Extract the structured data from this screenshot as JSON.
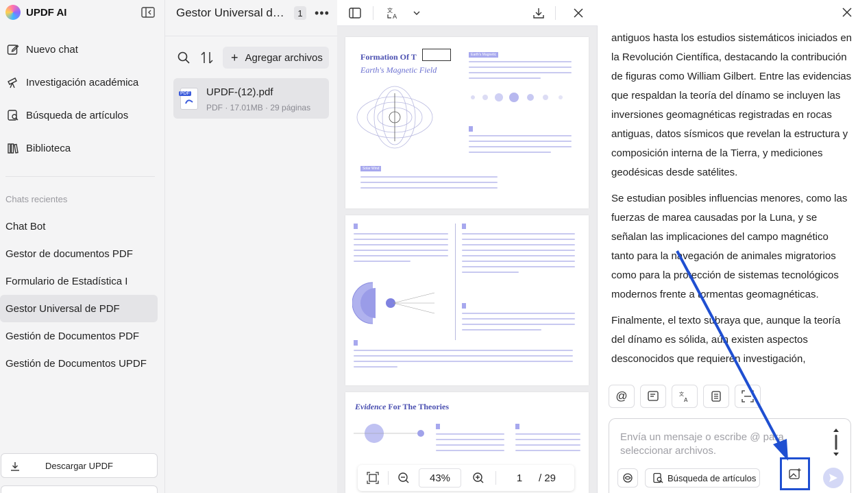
{
  "sidebar": {
    "brand": "UPDF AI",
    "nav": [
      {
        "label": "Nuevo chat"
      },
      {
        "label": "Investigación académica"
      },
      {
        "label": "Búsqueda de artículos"
      },
      {
        "label": "Biblioteca"
      }
    ],
    "recent_label": "Chats recientes",
    "recent": [
      {
        "label": "Chat Bot"
      },
      {
        "label": "Gestor de documentos PDF"
      },
      {
        "label": "Formulario de Estadística I"
      },
      {
        "label": "Gestor Universal de PDF"
      },
      {
        "label": "Gestión de Documentos PDF"
      },
      {
        "label": "Gestión de Documentos UPDF"
      }
    ],
    "download_label": "Descargar UPDF"
  },
  "files": {
    "title": "Gestor Universal de PDF",
    "count": "1",
    "add_label": "Agregar archivos",
    "items": [
      {
        "name": "UPDF-(12).pdf",
        "meta": "PDF · 17.01MB · 29 páginas",
        "tag": "PDF"
      }
    ]
  },
  "viewer": {
    "page1": {
      "title": "Formation Of T",
      "subtitle": "Earth's Magnetic Field",
      "tags": [
        "Earth's Magnetic",
        "Solar Wind"
      ]
    },
    "page3": {
      "title_italic": "Evidence",
      "title_rest": " For The Theories"
    },
    "zoom": "43%",
    "page_current": "1",
    "page_total": "/ 29"
  },
  "chat": {
    "paragraphs": [
      "antiguos hasta los estudios sistemáticos iniciados en la Revolución Científica, destacando la contribución de figuras como William Gilbert. Entre las evidencias que respaldan la teoría del dínamo se incluyen las inversiones geomagnéticas registradas en rocas antiguas, datos sísmicos que revelan la estructura y composición interna de la Tierra, y mediciones geodésicas desde satélites.",
      "Se estudian posibles influencias menores, como las fuerzas de marea causadas por la Luna, y se señalan las implicaciones del campo magnético tanto para la navegación de animales migratorios como para la protección de sistemas tecnológicos modernos frente a tormentas geomagnéticas.",
      "Finalmente, el texto subraya que, aunque la teoría del dínamo es sólida, aún existen aspectos desconocidos que requieren investigación,"
    ],
    "tools": [
      {
        "icon": "at-icon",
        "glyph": "@"
      },
      {
        "icon": "note-icon"
      },
      {
        "icon": "translate-icon"
      },
      {
        "icon": "outline-icon"
      },
      {
        "icon": "scan-icon"
      }
    ],
    "input_placeholder": "Envía un mensaje o escribe @ para seleccionar archivos.",
    "search_label": "Búsqueda de artículos"
  },
  "colors": {
    "accent": "#1f4fd1",
    "brand_purple": "#4a4fb0",
    "active_bg": "#e4e4e7"
  }
}
